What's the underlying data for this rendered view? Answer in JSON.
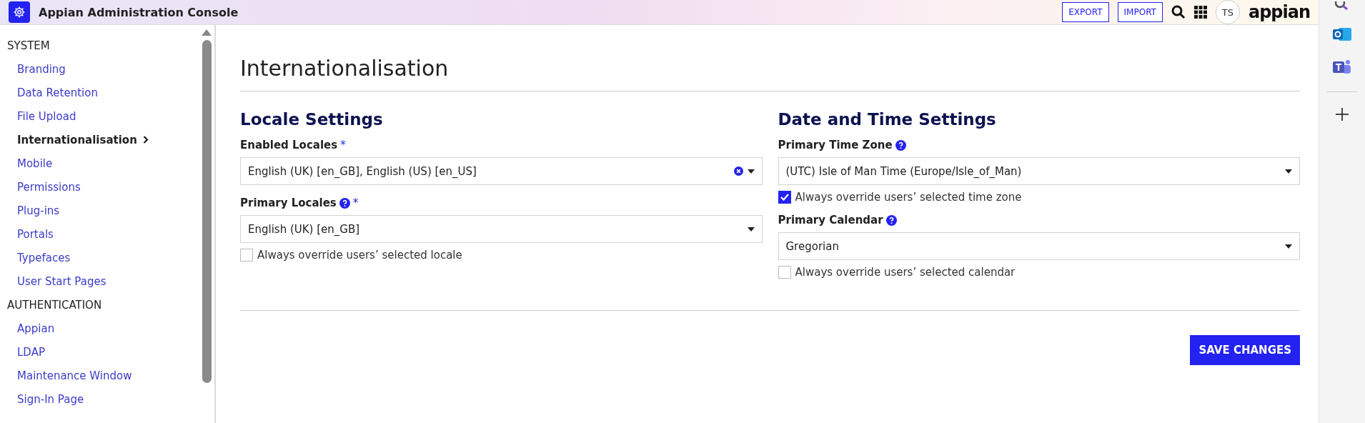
{
  "header": {
    "title": "Appian Administration Console",
    "buttons": [
      "EXPORT",
      "IMPORT"
    ],
    "avatar": "TS",
    "logo": "appian"
  },
  "sidebar": {
    "sections": [
      {
        "title": "SYSTEM",
        "items": [
          {
            "label": "Branding",
            "selected": false
          },
          {
            "label": "Data Retention",
            "selected": false
          },
          {
            "label": "File Upload",
            "selected": false
          },
          {
            "label": "Internationalisation",
            "selected": true
          },
          {
            "label": "Mobile",
            "selected": false
          },
          {
            "label": "Permissions",
            "selected": false
          },
          {
            "label": "Plug-ins",
            "selected": false
          },
          {
            "label": "Portals",
            "selected": false
          },
          {
            "label": "Typefaces",
            "selected": false
          },
          {
            "label": "User Start Pages",
            "selected": false
          }
        ]
      },
      {
        "title": "AUTHENTICATION",
        "items": [
          {
            "label": "Appian",
            "selected": false
          },
          {
            "label": "LDAP",
            "selected": false
          },
          {
            "label": "Maintenance Window",
            "selected": false
          },
          {
            "label": "Sign-In Page",
            "selected": false
          }
        ]
      }
    ]
  },
  "page": {
    "title": "Internationalisation",
    "columns": [
      {
        "heading": "Locale Settings",
        "fields": [
          {
            "kind": "select",
            "label": "Enabled Locales",
            "required_mark": "*",
            "help": false,
            "value": "English (UK) [en_GB], English (US) [en_US]",
            "clearable": true
          },
          {
            "kind": "select",
            "label": "Primary Locales",
            "required_mark": "*",
            "help": true,
            "value": "English (UK) [en_GB]",
            "clearable": false
          },
          {
            "kind": "checkbox",
            "label": "Always override users’ selected locale",
            "checked": false
          }
        ]
      },
      {
        "heading": "Date and Time Settings",
        "fields": [
          {
            "kind": "select",
            "label": "Primary Time Zone",
            "help": true,
            "value": "(UTC) Isle of Man Time (Europe/Isle_of_Man)",
            "clearable": false
          },
          {
            "kind": "checkbox",
            "label": "Always override users’ selected time zone",
            "checked": true
          },
          {
            "kind": "select",
            "label": "Primary Calendar",
            "help": true,
            "value": "Gregorian",
            "clearable": false
          },
          {
            "kind": "checkbox",
            "label": "Always override users’ selected calendar",
            "checked": false
          }
        ]
      }
    ],
    "save_button": "SAVE CHANGES"
  }
}
